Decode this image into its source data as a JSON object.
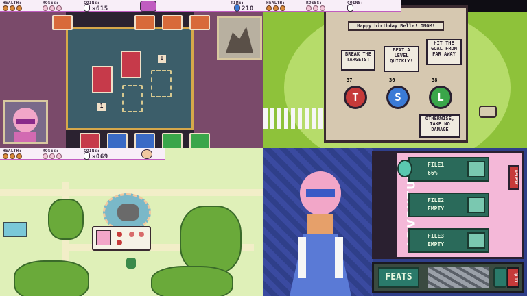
{
  "q1_card_game": {
    "hud": {
      "health_label": "HEALTH:",
      "roses_label": "ROSES:",
      "coins_label": "COINS:",
      "coins_value": "×615",
      "time_label": "TIME:",
      "time_value": "210"
    },
    "slot_counts": [
      "1",
      "0"
    ]
  },
  "q2_birthday_chest": {
    "hud": {
      "health_label": "HEALTH:",
      "roses_label": "ROSES:",
      "coins_label": "COINS:"
    },
    "chest_sign": "Happy birthday Belle! OMOM!",
    "notes": [
      "BREAK THE TARGETS!",
      "BEAT A LEVEL QUICKLY!",
      "HIT THE GOAL FROM FAR AWAY",
      "OTHERWISE, TAKE NO DAMAGE"
    ],
    "medals": [
      {
        "num": "37",
        "letter": "T",
        "color": "#c63a3a"
      },
      {
        "num": "36",
        "letter": "S",
        "color": "#3a7ad6"
      },
      {
        "num": "38",
        "letter": "L",
        "color": "#3aa64a"
      }
    ]
  },
  "q3_world_map": {
    "hud": {
      "health_label": "HEALTH:",
      "roses_label": "ROSES:",
      "coins_label": "COINS:",
      "coins_value": "×069"
    }
  },
  "q4_file_select": {
    "adventure": "ADVENTURE",
    "delete_label": "DELETE",
    "files": [
      {
        "name": "FILE1",
        "detail": "66%"
      },
      {
        "name": "FILE2",
        "detail": "EMPTY"
      },
      {
        "name": "FILE3",
        "detail": "EMPTY"
      }
    ],
    "feats": "FEATS",
    "quit": "QUIT"
  }
}
